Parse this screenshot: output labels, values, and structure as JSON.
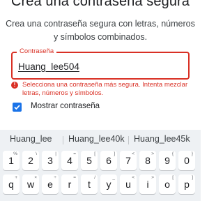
{
  "header": {
    "title": "Crea una contraseña segura",
    "subtitle": "Crea una contraseña segura con letras, números y símbolos combinados."
  },
  "password_field": {
    "label": "Contraseña",
    "value": "Huang_lee504"
  },
  "error": {
    "icon": "error-icon",
    "message": "Selecciona una contraseña más segura. Intenta mezclar letras, números y símbolos."
  },
  "show_password": {
    "label": "Mostrar contraseña",
    "checked": true
  },
  "keyboard": {
    "suggestions": [
      "Huang_lee",
      "Huang_lee40k",
      "Huang_lee45k"
    ],
    "digit_row": [
      {
        "main": "1",
        "hint": "%"
      },
      {
        "main": "2",
        "hint": "\\"
      },
      {
        "main": "3",
        "hint": "|"
      },
      {
        "main": "4",
        "hint": "="
      },
      {
        "main": "5",
        "hint": "["
      },
      {
        "main": "6",
        "hint": "]"
      },
      {
        "main": "7",
        "hint": "<"
      },
      {
        "main": "8",
        "hint": ">"
      },
      {
        "main": "9",
        "hint": "{"
      },
      {
        "main": "0",
        "hint": "}"
      }
    ],
    "letter_row": [
      {
        "main": "q",
        "hint": "+"
      },
      {
        "main": "w",
        "hint": "×"
      },
      {
        "main": "e",
        "hint": "÷"
      },
      {
        "main": "r",
        "hint": "="
      },
      {
        "main": "t",
        "hint": "/"
      },
      {
        "main": "y",
        "hint": "_"
      },
      {
        "main": "u",
        "hint": "<"
      },
      {
        "main": "i",
        "hint": ">"
      },
      {
        "main": "o",
        "hint": "["
      },
      {
        "main": "p",
        "hint": "]"
      }
    ]
  },
  "colors": {
    "error": "#d93025",
    "accent": "#1a73e8",
    "keyboard_bg": "#eef1f4"
  }
}
